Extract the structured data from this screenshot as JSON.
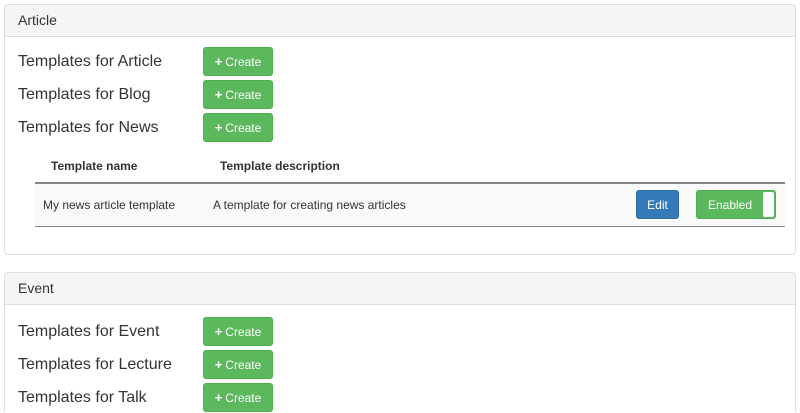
{
  "colors": {
    "success": "#5cb85c",
    "primary": "#337ab7",
    "panel_heading_bg": "#f5f5f5",
    "border": "#dddddd"
  },
  "icons": {
    "create": "plus-icon"
  },
  "article_panel": {
    "title": "Article",
    "rows": [
      {
        "label": "Templates for Article",
        "button": "Create"
      },
      {
        "label": "Templates for Blog",
        "button": "Create"
      },
      {
        "label": "Templates for News",
        "button": "Create"
      }
    ],
    "table": {
      "headers": [
        "Template name",
        "Template description"
      ],
      "rows": [
        {
          "name": "My news article template",
          "description": "A template for creating news articles",
          "edit_label": "Edit",
          "toggle_label": "Enabled",
          "toggle_on": true
        }
      ]
    }
  },
  "event_panel": {
    "title": "Event",
    "rows": [
      {
        "label": "Templates for Event",
        "button": "Create"
      },
      {
        "label": "Templates for Lecture",
        "button": "Create"
      },
      {
        "label": "Templates for Talk",
        "button": "Create"
      }
    ]
  }
}
